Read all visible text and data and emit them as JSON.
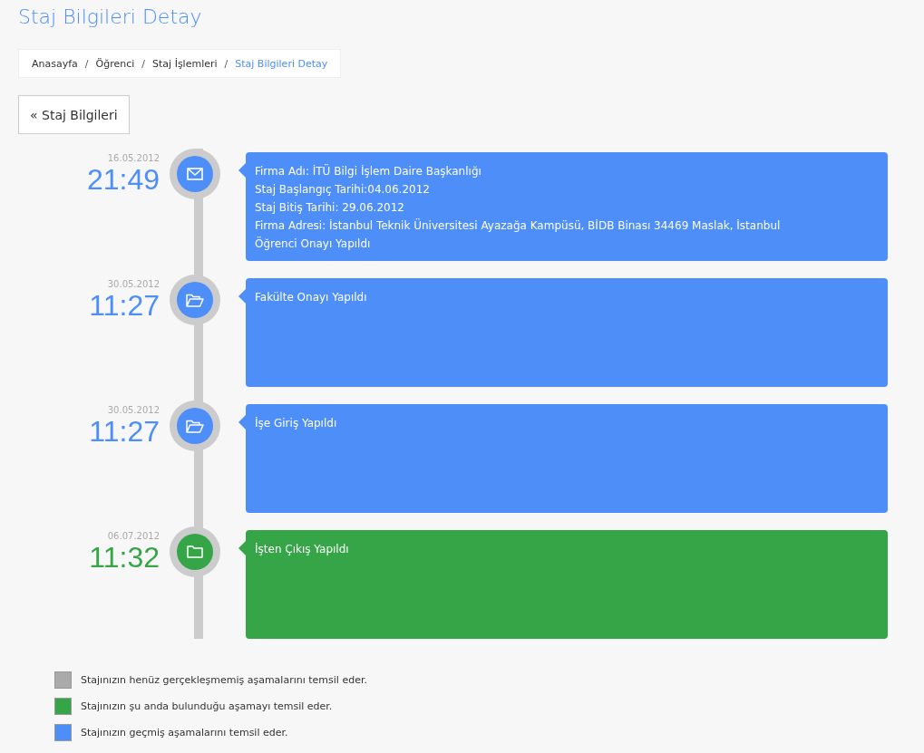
{
  "title": "Staj Bilgileri Detay",
  "breadcrumb": [
    {
      "label": "Anasayfa",
      "selected": false
    },
    {
      "label": "Öğrenci",
      "selected": false
    },
    {
      "label": "Staj İşlemleri",
      "selected": false
    },
    {
      "label": "Staj Bilgileri Detay",
      "selected": true
    }
  ],
  "breadcrumb_separator": "/",
  "back_button": {
    "icon": "«",
    "label": "Staj Bilgileri"
  },
  "events": [
    {
      "date": "16.05.2012",
      "time": "21:49",
      "kind": "envelope",
      "color": "#4d8ef8",
      "lines": [
        "Firma Adı: İTÜ Bilgi İşlem Daire Başkanlığı",
        "Staj Başlangıç Tarihi:04.06.2012",
        "Staj Bitiş Tarihi: 29.06.2012",
        "Firma Adresi: İstanbul Teknik Üniversitesi Ayazağa Kampüsü, BİDB Binası 34469 Maslak, İstanbul",
        "Öğrenci Onayı Yapıldı"
      ]
    },
    {
      "date": "30.05.2012",
      "time": "11:27",
      "kind": "folder-open",
      "color": "#4d8ef8",
      "lines": [
        "Fakülte Onayı Yapıldı"
      ]
    },
    {
      "date": "30.05.2012",
      "time": "11:27",
      "kind": "folder-open",
      "color": "#4d8ef8",
      "lines": [
        "İşe Giriş Yapıldı"
      ]
    },
    {
      "date": "06.07.2012",
      "time": "11:32",
      "kind": "folder",
      "color": "#36a547",
      "lines": [
        "İşten Çıkış Yapıldı"
      ]
    }
  ],
  "legend": [
    {
      "color": "#aaaaaa",
      "text": "Stajınızın henüz gerçekleşmemiş aşamalarını temsil eder."
    },
    {
      "color": "#36a547",
      "text": "Stajınızın şu anda bulunduğu aşamayı temsil eder."
    },
    {
      "color": "#4d8ef8",
      "text": "Stajınızın geçmiş aşamalarını temsil eder."
    }
  ]
}
